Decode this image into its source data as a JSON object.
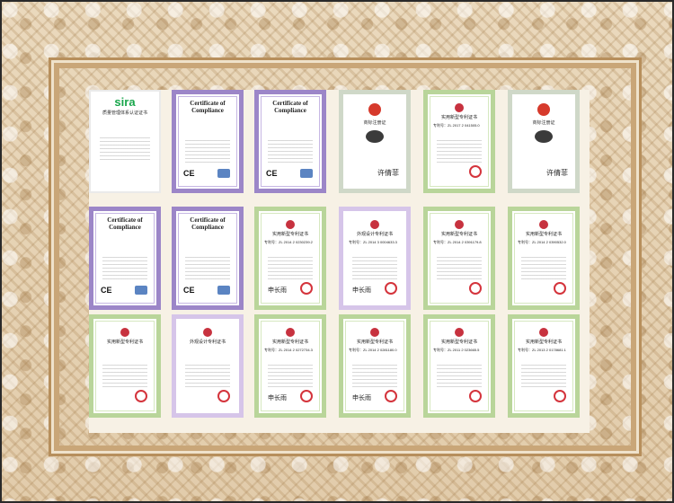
{
  "certificates": [
    {
      "type": "sira",
      "logo": "sira",
      "subtitle": "质量管理体系认证证书",
      "row": 0,
      "col": 0
    },
    {
      "type": "compliance",
      "title": "Certificate of Compliance",
      "mark": "CE",
      "row": 0,
      "col": 1
    },
    {
      "type": "compliance",
      "title": "Certificate of Compliance",
      "mark": "CE",
      "row": 0,
      "col": 2
    },
    {
      "type": "trademark",
      "title": "商标注册证",
      "signature": "许倩菲",
      "row": 0,
      "col": 3
    },
    {
      "type": "patent",
      "title": "实用新型专利证书",
      "number": "专利号：ZL 2017 2 041505.0",
      "signature": "",
      "row": 0,
      "col": 4
    },
    {
      "type": "trademark",
      "title": "商标注册证",
      "signature": "许倩菲",
      "row": 0,
      "col": 5
    },
    {
      "type": "compliance",
      "title": "Certificate of Compliance",
      "mark": "CE",
      "row": 1,
      "col": 0
    },
    {
      "type": "compliance",
      "title": "Certificate of Compliance",
      "mark": "CE",
      "row": 1,
      "col": 1
    },
    {
      "type": "patent",
      "title": "实用新型专利证书",
      "number": "专利号：ZL 2014 2 0230239.2",
      "signature": "申长雨",
      "row": 1,
      "col": 2
    },
    {
      "type": "design",
      "title": "外观设计专利证书",
      "number": "专利号：ZL 2014 3 0004633.3",
      "signature": "申长雨",
      "row": 1,
      "col": 3
    },
    {
      "type": "patent",
      "title": "实用新型专利证书",
      "number": "专利号：ZL 2014 2 0391179.8",
      "signature": "",
      "row": 1,
      "col": 4
    },
    {
      "type": "patent",
      "title": "实用新型专利证书",
      "number": "专利号：ZL 2014 2 0390532.0",
      "signature": "",
      "row": 1,
      "col": 5
    },
    {
      "type": "patent",
      "title": "实用新型专利证书",
      "number": "",
      "signature": "",
      "row": 2,
      "col": 0
    },
    {
      "type": "design",
      "title": "外观设计专利证书",
      "number": "",
      "signature": "",
      "row": 2,
      "col": 1
    },
    {
      "type": "patent",
      "title": "实用新型专利证书",
      "number": "专利号：ZL 2014 2 0272734.3",
      "signature": "申长雨",
      "row": 2,
      "col": 2
    },
    {
      "type": "patent",
      "title": "实用新型专利证书",
      "number": "专利号：ZL 2014 2 0281180.0",
      "signature": "申长雨",
      "row": 2,
      "col": 3
    },
    {
      "type": "patent",
      "title": "实用新型专利证书",
      "number": "专利号：ZL 2011 2 023665.5",
      "signature": "",
      "row": 2,
      "col": 4
    },
    {
      "type": "patent",
      "title": "实用新型专利证书",
      "number": "专利号：ZL 2013 2 0178681.1",
      "signature": "",
      "row": 2,
      "col": 5
    }
  ],
  "colors": {
    "frame": "#e6d3b5",
    "board": "#f7f1e5",
    "green_accent": "#18a64b",
    "purple_accent": "#9c86c8",
    "patent_green": "#b9d59a",
    "seal_red": "#d4343c"
  }
}
